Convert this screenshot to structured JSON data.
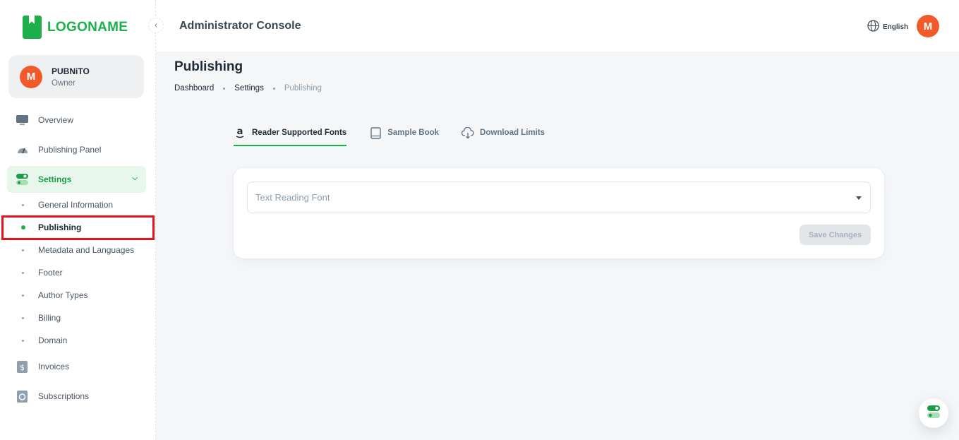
{
  "brand": {
    "logo_text": "LOGONAME",
    "accent": "#1db04a"
  },
  "account": {
    "avatar_letter": "M",
    "name": "PUBNiTO",
    "role": "Owner"
  },
  "sidebar": {
    "items": [
      {
        "label": "Overview",
        "icon": "monitor-icon"
      },
      {
        "label": "Publishing Panel",
        "icon": "gauge-icon"
      },
      {
        "label": "Settings",
        "icon": "toggle-icon"
      },
      {
        "label": "Invoices",
        "icon": "dollar-document-icon"
      },
      {
        "label": "Subscriptions",
        "icon": "subscription-icon"
      }
    ],
    "settings_sub": [
      {
        "label": "General Information"
      },
      {
        "label": "Publishing"
      },
      {
        "label": "Metadata and Languages"
      },
      {
        "label": "Footer"
      },
      {
        "label": "Author Types"
      },
      {
        "label": "Billing"
      },
      {
        "label": "Domain"
      }
    ]
  },
  "header": {
    "title": "Administrator Console",
    "language": "English",
    "avatar_letter": "M"
  },
  "page": {
    "title": "Publishing"
  },
  "breadcrumb": [
    "Dashboard",
    "Settings",
    "Publishing"
  ],
  "tabs": [
    {
      "label": "Reader Supported Fonts",
      "icon": "amazon-icon",
      "active": true
    },
    {
      "label": "Sample Book",
      "icon": "book-icon",
      "active": false
    },
    {
      "label": "Download Limits",
      "icon": "cloud-download-icon",
      "active": false
    }
  ],
  "form": {
    "font_select_placeholder": "Text Reading Font",
    "save_label": "Save Changes"
  }
}
